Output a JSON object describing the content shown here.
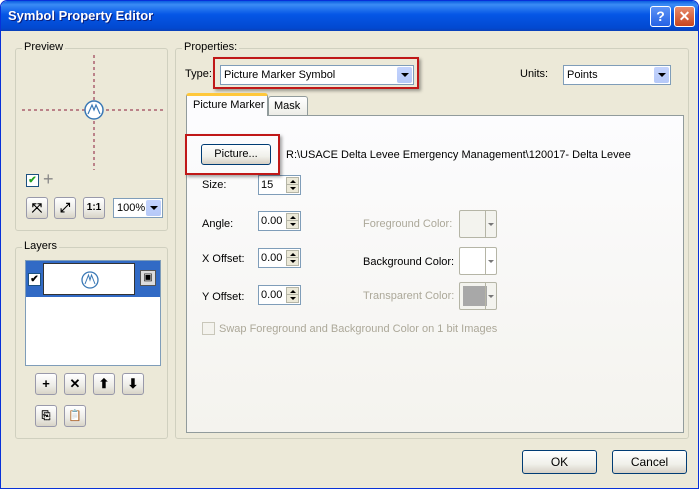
{
  "window": {
    "title": "Symbol Property Editor",
    "help_label": "?",
    "close_label": "✕"
  },
  "preview": {
    "group_label": "Preview",
    "checkbox_checked": true,
    "zoom_value": "100%"
  },
  "layers": {
    "group_label": "Layers"
  },
  "properties": {
    "group_label": "Properties:",
    "type_label": "Type:",
    "type_value": "Picture Marker Symbol",
    "units_label": "Units:",
    "units_value": "Points"
  },
  "tabs": [
    {
      "label": "Picture Marker",
      "active": true
    },
    {
      "label": "Mask",
      "active": false
    }
  ],
  "picture": {
    "button_label": "Picture...",
    "path": "R:\\USACE Delta Levee Emergency Management\\120017- Delta Levee"
  },
  "fields": {
    "size_label": "Size:",
    "size_value": "15",
    "angle_label": "Angle:",
    "angle_value": "0.00",
    "xoffset_label": "X Offset:",
    "xoffset_value": "0.00",
    "yoffset_label": "Y Offset:",
    "yoffset_value": "0.00"
  },
  "colors": {
    "foreground_label": "Foreground Color:",
    "background_label": "Background Color:",
    "transparent_label": "Transparent Color:",
    "transparent_swatch": "#a8a8a8"
  },
  "swap_label": "Swap Foreground and Background Color on 1 bit Images",
  "footer": {
    "ok_label": "OK",
    "cancel_label": "Cancel"
  }
}
